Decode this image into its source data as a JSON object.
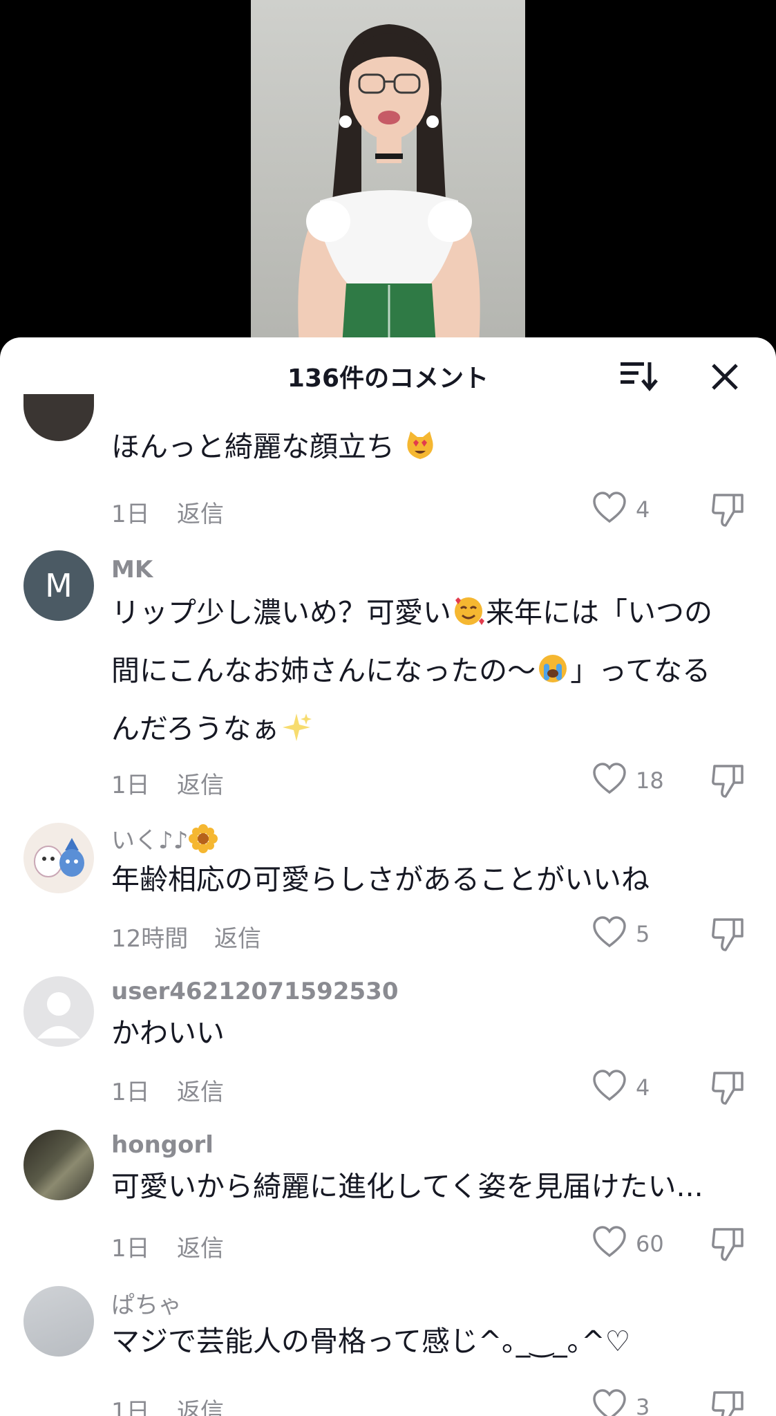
{
  "header": {
    "title": "136件のコメント"
  },
  "comments": [
    {
      "username": "",
      "text": "ほんっと綺麗な顔立ち",
      "time": "1日",
      "reply_label": "返信",
      "likes": "4"
    },
    {
      "username": "MK",
      "avatar_letter": "M",
      "avatar_color": "#4b5a64",
      "text_line1": "リップ少し濃いめ？可愛い",
      "text_line1b": "来年には「いつの",
      "text_line2a": "間にこんなお姉さんになったの〜",
      "text_line2b": "」ってなる",
      "text_line3": "んだろうなぁ",
      "time": "1日",
      "reply_label": "返信",
      "likes": "18"
    },
    {
      "username": "いく♪♪",
      "text": "年齢相応の可愛らしさがあることがいいね",
      "time": "12時間",
      "reply_label": "返信",
      "likes": "5"
    },
    {
      "username": "user46212071592530",
      "text": "かわいい",
      "time": "1日",
      "reply_label": "返信",
      "likes": "4"
    },
    {
      "username": "hongorl",
      "text": "可愛いから綺麗に進化してく姿を見届けたい...",
      "time": "1日",
      "reply_label": "返信",
      "likes": "60"
    },
    {
      "username": "ぱちゃ",
      "text": "マジで芸能人の骨格って感じ^｡_‿_｡^♡",
      "time": "1日",
      "reply_label": "返信",
      "likes": "3"
    }
  ],
  "icons": {
    "sort": "sort-icon",
    "close": "close-icon",
    "like": "heart-icon",
    "dislike": "thumbs-down-icon"
  },
  "colors": {
    "text": "#161823",
    "muted": "#8a8b91",
    "sheet": "#ffffff"
  }
}
